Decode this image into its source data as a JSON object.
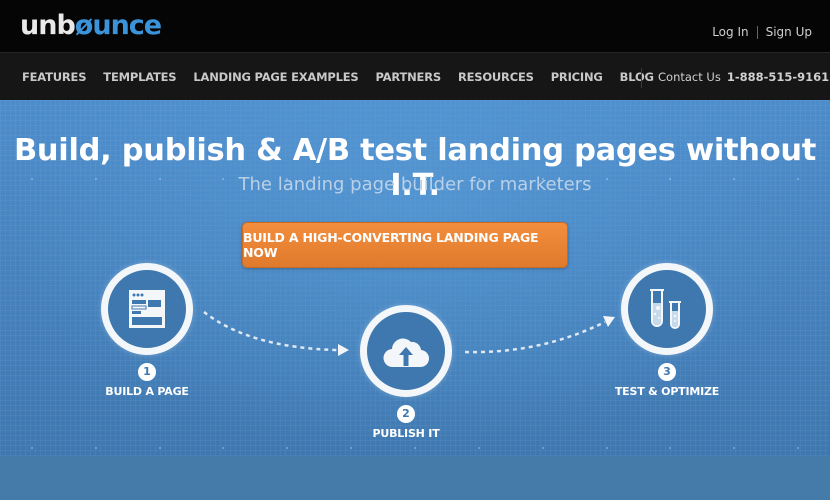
{
  "header": {
    "logo": {
      "part1": "unb",
      "part2": "ounce",
      "o_char": "ø"
    },
    "auth": {
      "login": "Log In",
      "signup": "Sign Up"
    }
  },
  "nav": {
    "items": [
      {
        "label": "FEATURES"
      },
      {
        "label": "TEMPLATES"
      },
      {
        "label": "LANDING PAGE EXAMPLES"
      },
      {
        "label": "PARTNERS"
      },
      {
        "label": "RESOURCES"
      },
      {
        "label": "PRICING"
      },
      {
        "label": "BLOG"
      }
    ],
    "contact_label": "Contact Us",
    "phone": "1-888-515-9161"
  },
  "hero": {
    "headline": "Build, publish & A/B test landing pages without I.T.",
    "subhead": "The landing page builder for marketers",
    "cta": "BUILD A HIGH-CONVERTING LANDING PAGE NOW"
  },
  "steps": [
    {
      "number": "1",
      "label": "BUILD A PAGE",
      "icon": "page-builder-icon"
    },
    {
      "number": "2",
      "label": "PUBLISH IT",
      "icon": "cloud-upload-icon"
    },
    {
      "number": "3",
      "label": "TEST & OPTIMIZE",
      "icon": "test-tubes-icon"
    }
  ],
  "colors": {
    "topbar": "#050505",
    "navbar": "#161616",
    "brand_blue": "#3b93d9",
    "hero_blue": "#4d8ccb",
    "cta_orange": "#f28e3e"
  }
}
